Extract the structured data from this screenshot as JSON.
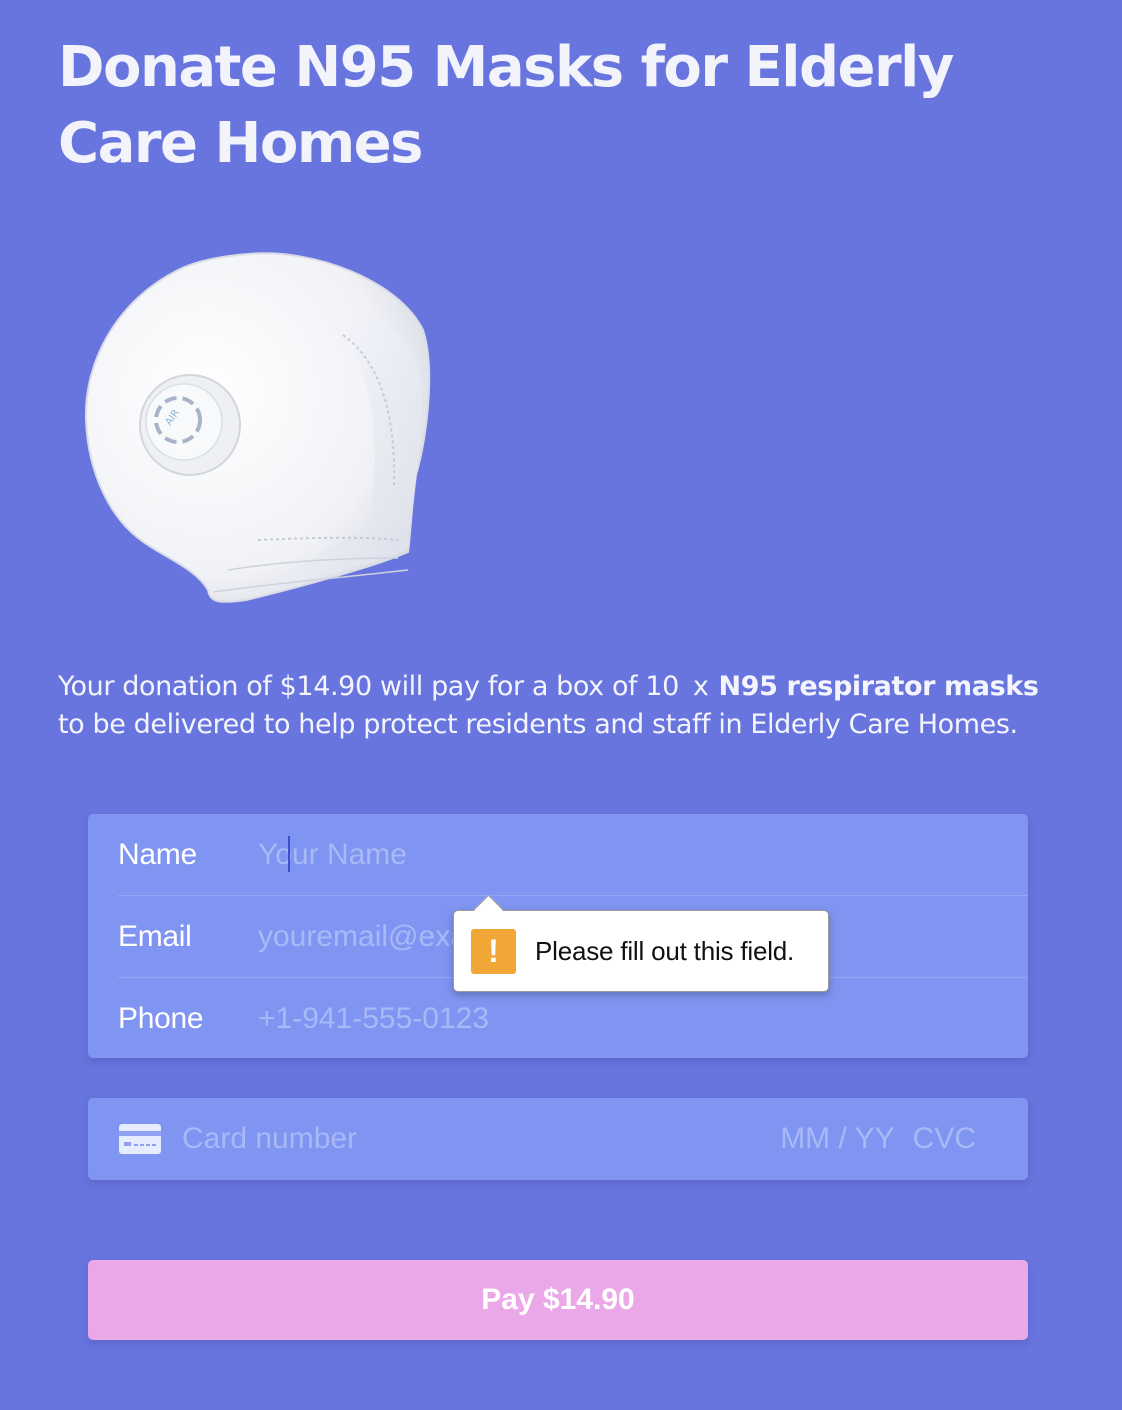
{
  "page": {
    "title": "Donate N95 Masks for Elderly Care Homes",
    "mask_image": "n95-mask-image",
    "valve_text": "AIR"
  },
  "description": {
    "prefix": "Your donation of $14.90 will pay for a box of 10",
    "multiplier": "x",
    "product": "N95 respirator masks",
    "suffix": "to be delivered to help protect residents and staff in Elderly Care Homes."
  },
  "form": {
    "fields": [
      {
        "label": "Name",
        "placeholder": "Your Name",
        "value": ""
      },
      {
        "label": "Email",
        "placeholder": "youremail@example.com",
        "value": ""
      },
      {
        "label": "Phone",
        "placeholder": "+1-941-555-0123",
        "value": ""
      }
    ],
    "card": {
      "icon": "credit-card-icon",
      "number_placeholder": "Card number",
      "expiry_placeholder": "MM / YY",
      "cvc_placeholder": "CVC"
    },
    "pay_button_label": "Pay $14.90"
  },
  "validation_tooltip": {
    "icon": "warning-icon",
    "message": "Please fill out this field.",
    "icon_color": "#f1a735"
  },
  "colors": {
    "background": "#6875de",
    "field_box": "#7f95f1",
    "pay_button": "#eaa8e8"
  }
}
